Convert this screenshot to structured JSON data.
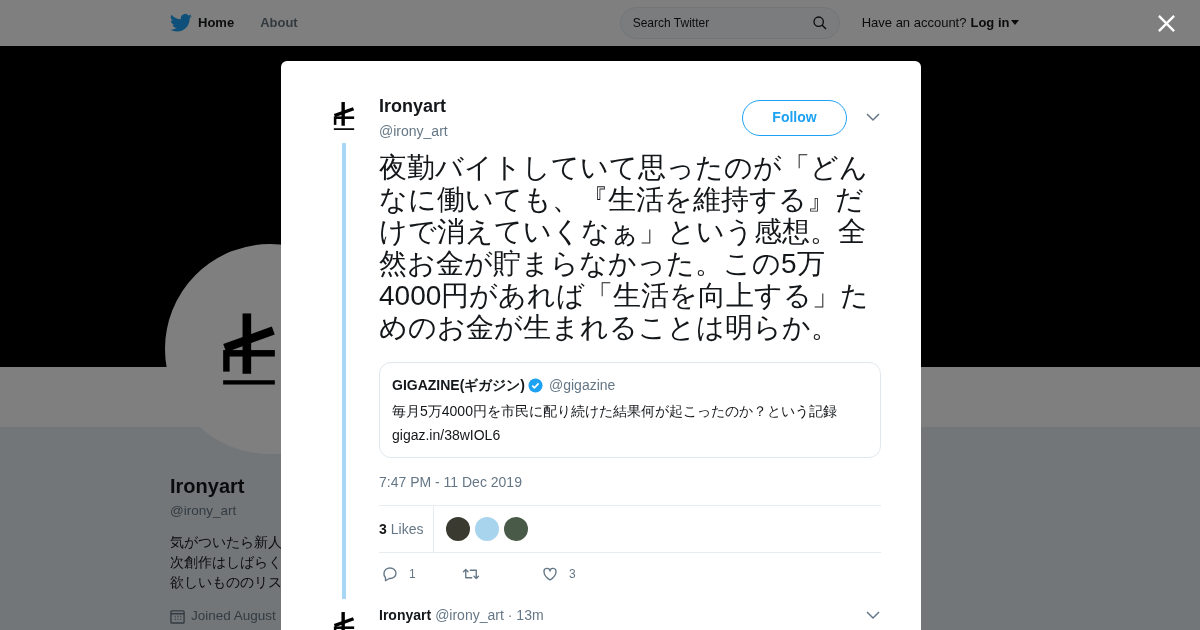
{
  "header": {
    "nav": [
      {
        "label": "Home",
        "selected": true
      },
      {
        "label": "About",
        "selected": false
      }
    ],
    "search": {
      "placeholder": "Search Twitter"
    },
    "account_prompt": "Have an account?",
    "login": "Log in"
  },
  "profile": {
    "name": "Ironyart",
    "handle": "@irony_art",
    "bio_lines": [
      "気がついたら新人",
      "次創作はしばらく",
      "欲しいもののリス"
    ],
    "joined": "Joined August"
  },
  "modal": {
    "author": {
      "name": "Ironyart",
      "handle": "@irony_art"
    },
    "follow": "Follow",
    "text": "夜勤バイトしていて思ったのが「どんなに働いても、『生活を維持する』だけで消えていくなぁ」という感想。全然お金が貯まらなかった。この5万4000円があれば「生活を向上する」ためのお金が生まれることは明らか。",
    "quote": {
      "name": "GIGAZINE(ギガジン)",
      "verified": true,
      "handle": "@gigazine",
      "text": "毎月5万4000円を市民に配り続けた結果何が起こったのか？という記録",
      "link": "gigaz.in/38wIOL6"
    },
    "time": "7:47 PM - 11 Dec 2019",
    "likes_count": "3",
    "likes_label": "Likes",
    "likers": [
      {
        "color": "#3a3a30"
      },
      {
        "color": "#a8d4ee"
      },
      {
        "color": "#4a5a48"
      }
    ],
    "actions": [
      {
        "kind": "reply",
        "count": "1"
      },
      {
        "kind": "retweet"
      },
      {
        "kind": "like",
        "count": "3"
      }
    ],
    "reply": {
      "name": "Ironyart",
      "handle": "@irony_art",
      "time": "· 13m"
    }
  }
}
